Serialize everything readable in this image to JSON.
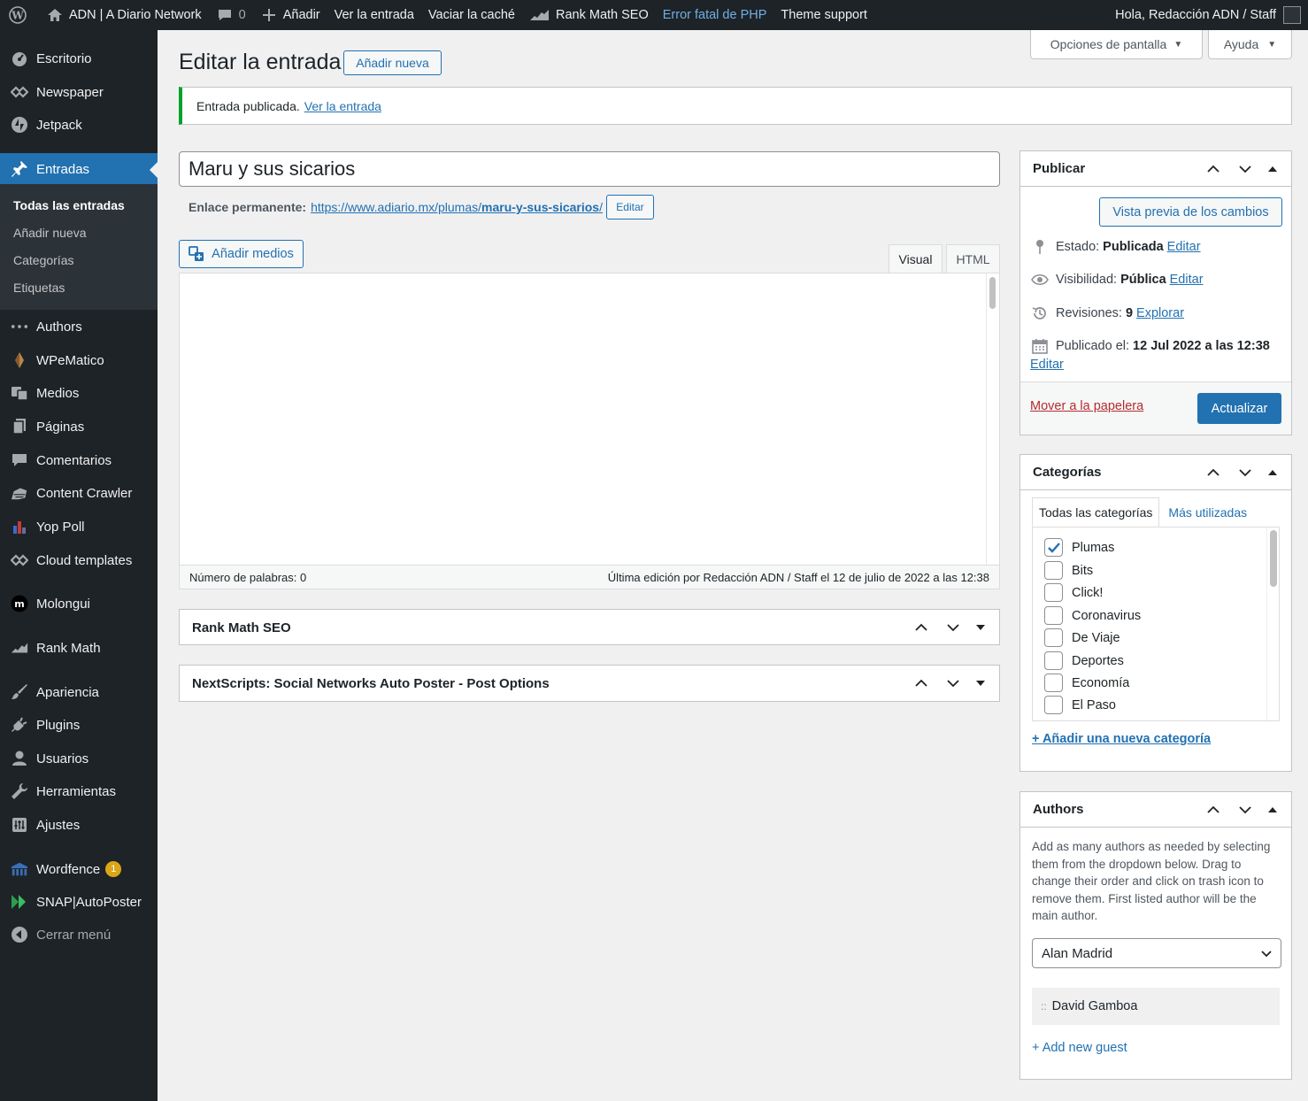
{
  "adminbar": {
    "site_name": "ADN | A Diario Network",
    "comments_count": "0",
    "add_new": "Añadir",
    "view_post": "Ver la entrada",
    "clear_cache": "Vaciar la caché",
    "rank_math": "Rank Math SEO",
    "php_error": "Error fatal de PHP",
    "theme_support": "Theme support",
    "greeting": "Hola, Redacción ADN / Staff"
  },
  "sidebar": {
    "items": [
      {
        "label": "Escritorio",
        "icon": "dashboard-icon"
      },
      {
        "label": "Newspaper",
        "icon": "newspaper-icon"
      },
      {
        "label": "Jetpack",
        "icon": "jetpack-icon"
      },
      {
        "label": "Entradas",
        "icon": "pin-icon"
      },
      {
        "label": "Authors",
        "icon": "dots-icon"
      },
      {
        "label": "WPeMatico",
        "icon": "wpematico-icon"
      },
      {
        "label": "Medios",
        "icon": "media-icon"
      },
      {
        "label": "Páginas",
        "icon": "pages-icon"
      },
      {
        "label": "Comentarios",
        "icon": "comments-icon"
      },
      {
        "label": "Content Crawler",
        "icon": "crawler-icon"
      },
      {
        "label": "Yop Poll",
        "icon": "poll-icon"
      },
      {
        "label": "Cloud templates",
        "icon": "cloud-icon"
      },
      {
        "label": "Molongui",
        "icon": "molongui-icon"
      },
      {
        "label": "Rank Math",
        "icon": "rankmath-icon"
      },
      {
        "label": "Apariencia",
        "icon": "brush-icon"
      },
      {
        "label": "Plugins",
        "icon": "plug-icon"
      },
      {
        "label": "Usuarios",
        "icon": "user-icon"
      },
      {
        "label": "Herramientas",
        "icon": "wrench-icon"
      },
      {
        "label": "Ajustes",
        "icon": "settings-icon"
      },
      {
        "label": "Wordfence",
        "icon": "wordfence-icon",
        "badge": "1"
      },
      {
        "label": "SNAP|AutoPoster",
        "icon": "snap-icon"
      },
      {
        "label": "Cerrar menú",
        "icon": "collapse-icon"
      }
    ],
    "submenu": [
      "Todas las entradas",
      "Añadir nueva",
      "Categorías",
      "Etiquetas"
    ]
  },
  "header": {
    "title": "Editar la entrada",
    "add_new": "Añadir nueva",
    "screen_options": "Opciones de pantalla",
    "help": "Ayuda"
  },
  "notice": {
    "text": "Entrada publicada.",
    "link": "Ver la entrada"
  },
  "post": {
    "title": "Maru y sus sicarios",
    "permalink_label": "Enlace permanente:",
    "permalink_base": "https://www.adiario.mx/plumas/",
    "permalink_slug": "maru-y-sus-sicarios",
    "permalink_end": "/",
    "edit_slug": "Editar"
  },
  "editor": {
    "add_media": "Añadir medios",
    "tab_visual": "Visual",
    "tab_html": "HTML",
    "word_count": "Número de palabras: 0",
    "last_edit": "Última edición por Redacción ADN / Staff el 12 de julio de 2022 a las 12:38"
  },
  "boxes": {
    "rankmath": "Rank Math SEO",
    "nextscripts": "NextScripts: Social Networks Auto Poster - Post Options"
  },
  "publish": {
    "title": "Publicar",
    "preview": "Vista previa de los cambios",
    "status_label": "Estado:",
    "status_value": "Publicada",
    "visibility_label": "Visibilidad:",
    "visibility_value": "Pública",
    "revisions_label": "Revisiones:",
    "revisions_value": "9",
    "explore": "Explorar",
    "published_label": "Publicado el:",
    "published_value": "12 Jul 2022 a las 12:38",
    "edit": "Editar",
    "trash": "Mover a la papelera",
    "update": "Actualizar"
  },
  "categories": {
    "title": "Categorías",
    "tab_all": "Todas las categorías",
    "tab_popular": "Más utilizadas",
    "items": [
      {
        "label": "Plumas",
        "checked": true
      },
      {
        "label": "Bits",
        "checked": false
      },
      {
        "label": "Click!",
        "checked": false
      },
      {
        "label": "Coronavirus",
        "checked": false
      },
      {
        "label": "De Viaje",
        "checked": false
      },
      {
        "label": "Deportes",
        "checked": false
      },
      {
        "label": "Economía",
        "checked": false
      },
      {
        "label": "El Paso",
        "checked": false
      }
    ],
    "add_new": "+ Añadir una nueva categoría"
  },
  "authors": {
    "title": "Authors",
    "description": "Add as many authors as needed by selecting them from the dropdown below. Drag to change their order and click on trash icon to remove them. First listed author will be the main author.",
    "selected": "Alan Madrid",
    "guest": "David Gamboa",
    "add_guest": "+ Add new guest"
  }
}
